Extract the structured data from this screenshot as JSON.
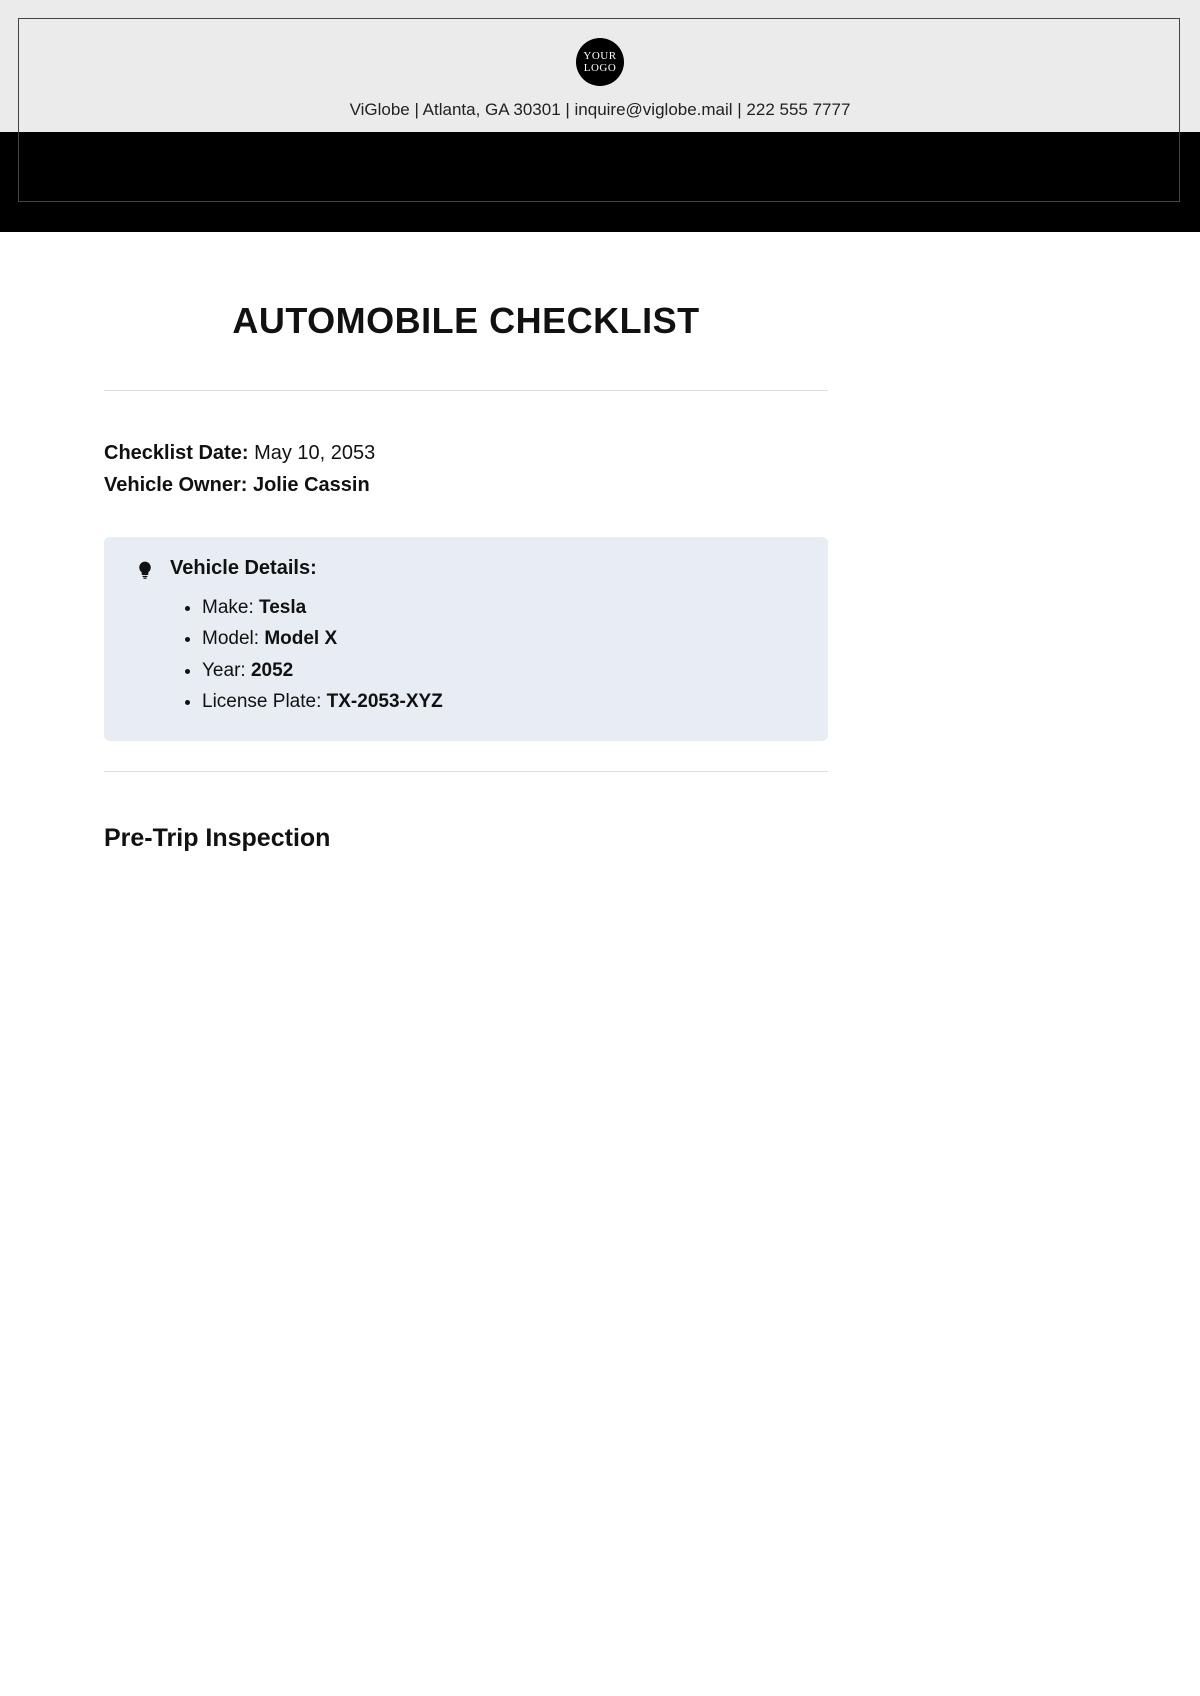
{
  "header": {
    "logo_top": "YOUR",
    "logo_bottom": "LOGO",
    "contact": "ViGlobe | Atlanta, GA 30301 | inquire@viglobe.mail | 222 555 7777"
  },
  "title": "AUTOMOBILE CHECKLIST",
  "meta": {
    "date_label": "Checklist Date:",
    "date_value": "May 10, 2053",
    "owner_label": "Vehicle Owner:",
    "owner_value": "Jolie Cassin"
  },
  "vehicle_details": {
    "heading": "Vehicle Details:",
    "items": [
      {
        "label": "Make:",
        "value": "Tesla"
      },
      {
        "label": "Model:",
        "value": "Model X"
      },
      {
        "label": "Year:",
        "value": "2052"
      },
      {
        "label": "License Plate:",
        "value": "TX-2053-XYZ"
      }
    ]
  },
  "section1": "Pre-Trip Inspection"
}
